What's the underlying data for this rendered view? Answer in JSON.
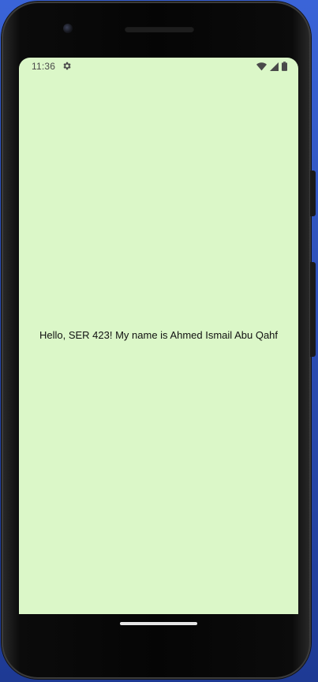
{
  "status_bar": {
    "time": "11:36",
    "icons": [
      "settings-gear-icon",
      "wifi-icon",
      "cell-signal-icon",
      "battery-icon"
    ]
  },
  "content": {
    "greeting": "Hello, SER 423! My name is Ahmed Ismail Abu Qahf"
  },
  "colors": {
    "screen_background": "#dbf7c8",
    "text": "#111111",
    "status_icons": "#4a4a4a"
  }
}
